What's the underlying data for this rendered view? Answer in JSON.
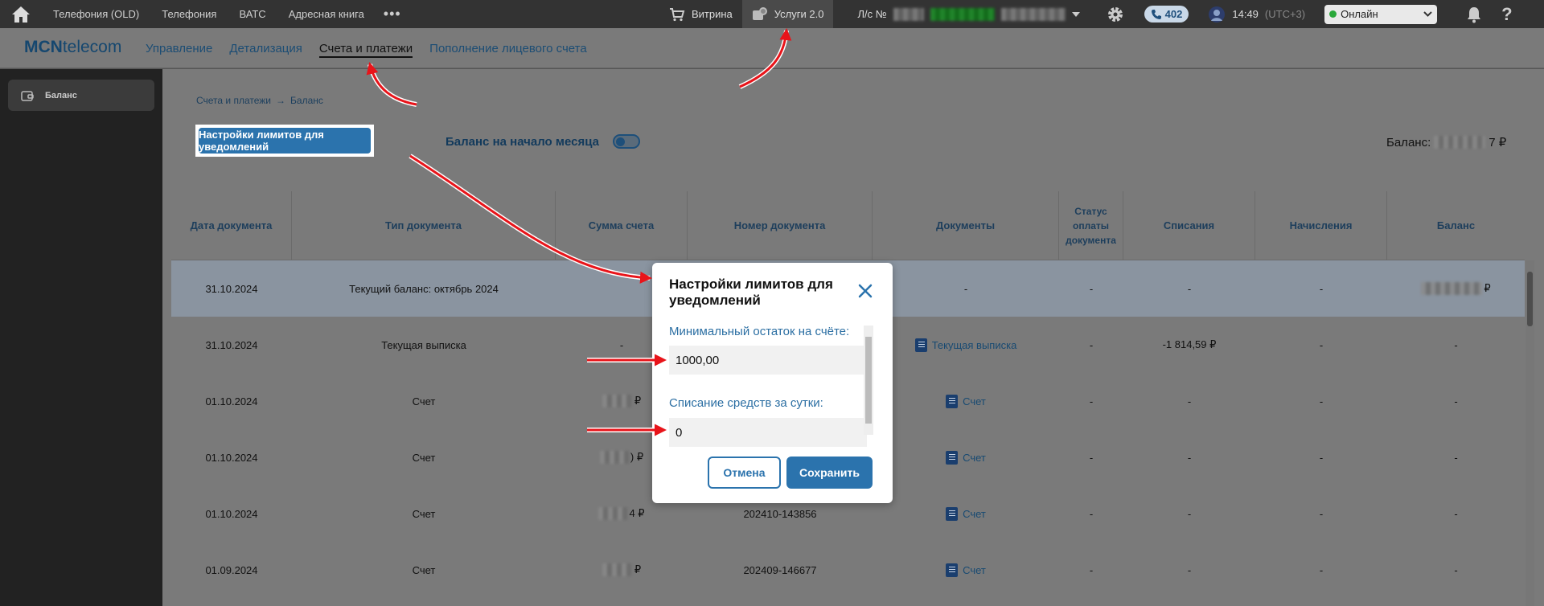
{
  "topbar": {
    "nav": [
      "Телефония (OLD)",
      "Телефония",
      "ВАТС",
      "Адресная книга"
    ],
    "more": "•••",
    "showcase": "Витрина",
    "services": "Услуги 2.0",
    "account_label": "Л/с №",
    "calls_count": "402",
    "time": "14:49",
    "timezone": "(UTC+3)",
    "status": "Онлайн",
    "help": "?"
  },
  "brand": {
    "logo_bold": "MCN",
    "logo_rest": "telecom"
  },
  "mainnav": [
    "Управление",
    "Детализация",
    "Счета и платежи",
    "Пополнение лицевого счета"
  ],
  "sidebar": {
    "balance": "Баланс"
  },
  "breadcrumb": {
    "parent": "Счета и платежи",
    "sep": "→",
    "current": "Баланс"
  },
  "toolbar": {
    "limits_button": "Настройки лимитов для уведомлений",
    "month_balance": "Баланс на начало месяца",
    "balance_label": "Баланс:",
    "balance_suffix": "7 ₽"
  },
  "table": {
    "headers": [
      "Дата документа",
      "Тип документа",
      "Сумма счета",
      "Номер документа",
      "Документы",
      "Статус оплаты документа",
      "Списания",
      "Начисления",
      "Баланс"
    ],
    "rows": [
      {
        "date": "31.10.2024",
        "type": "Текущий баланс: октябрь 2024",
        "sum": "",
        "number": "",
        "docs": "-",
        "status": "-",
        "debit": "-",
        "credit": "-",
        "balance": "₽"
      },
      {
        "date": "31.10.2024",
        "type": "Текущая выписка",
        "sum": "-",
        "number": "",
        "docs": "Текущая выписка",
        "status": "-",
        "debit": "-1 814,59 ₽",
        "credit": "-",
        "balance": "-"
      },
      {
        "date": "01.10.2024",
        "type": "Счет",
        "sum": "₽",
        "number": "",
        "docs": "Счет",
        "status": "-",
        "debit": "-",
        "credit": "-",
        "balance": "-"
      },
      {
        "date": "01.10.2024",
        "type": "Счет",
        "sum": ") ₽",
        "number": "",
        "docs": "Счет",
        "status": "-",
        "debit": "-",
        "credit": "-",
        "balance": "-"
      },
      {
        "date": "01.10.2024",
        "type": "Счет",
        "sum": "4 ₽",
        "number": "202410-143856",
        "docs": "Счет",
        "status": "-",
        "debit": "-",
        "credit": "-",
        "balance": "-"
      },
      {
        "date": "01.09.2024",
        "type": "Счет",
        "sum": "₽",
        "number": "202409-146677",
        "docs": "Счет",
        "status": "-",
        "debit": "-",
        "credit": "-",
        "balance": "-"
      }
    ]
  },
  "modal": {
    "title": "Настройки лимитов для уведомлений",
    "min_balance_label": "Минимальный остаток на счёте:",
    "min_balance_value": "1000,00",
    "daily_label": "Списание средств за сутки:",
    "daily_value": "0",
    "cancel": "Отмена",
    "save": "Сохранить"
  },
  "colors": {
    "accent": "#2b73ad",
    "annotation": "#e8141a"
  }
}
